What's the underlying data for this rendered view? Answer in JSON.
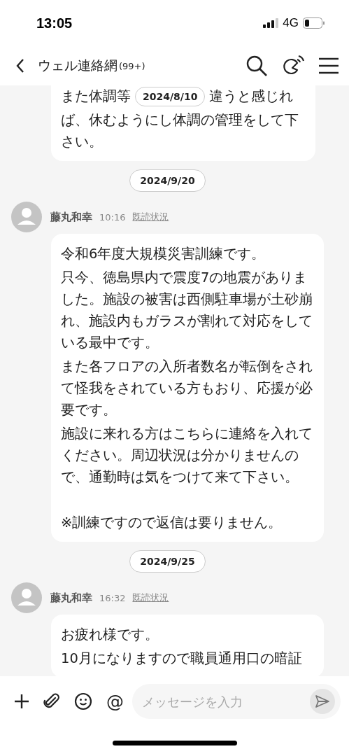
{
  "status_bar": {
    "time": "13:05",
    "network": "4G"
  },
  "header": {
    "title": "ウェル連絡網",
    "count": "(99+)"
  },
  "top_bubble": {
    "first_line_left": "また体調等",
    "sticky_date": "2024/8/10",
    "first_line_right": "違うと感じれ",
    "rest": "ば、休むようにし体調の管理をして下さい。"
  },
  "days": [
    {
      "date": "2024/9/20",
      "messages": [
        {
          "sender": "藤丸和幸",
          "time": "10:16",
          "read_status": "既読状況",
          "paragraphs": [
            {
              "kind": "normal",
              "text": "令和6年度大規模災害訓練です。"
            },
            {
              "kind": "normal",
              "text": "只今、徳島県内で震度7の地震がありました。施設の被害は西側駐車場が土砂崩れ、施設内もガラスが割れて対応をしている最中です。"
            },
            {
              "kind": "normal",
              "text": "また各フロアの入所者数名が転倒をされて怪我をされている方もおり、応援が必要です。"
            },
            {
              "kind": "normal",
              "text": "施設に来れる方はこちらに連絡を入れてください。周辺状況は分かりませんので、通勤時は気をつけて来て下さい。"
            },
            {
              "kind": "after_blank",
              "text": "※訓練ですので返信は要りません。"
            }
          ]
        }
      ]
    },
    {
      "date": "2024/9/25",
      "messages": [
        {
          "sender": "藤丸和幸",
          "time": "16:32",
          "read_status": "既読状況",
          "paragraphs": [
            {
              "kind": "normal",
              "text": "お疲れ様です。"
            },
            {
              "kind": "normal",
              "text": "10月になりますので職員通用口の暗証"
            }
          ]
        }
      ]
    }
  ],
  "composer": {
    "mention_symbol": "@",
    "placeholder": "メッセージを入力"
  }
}
